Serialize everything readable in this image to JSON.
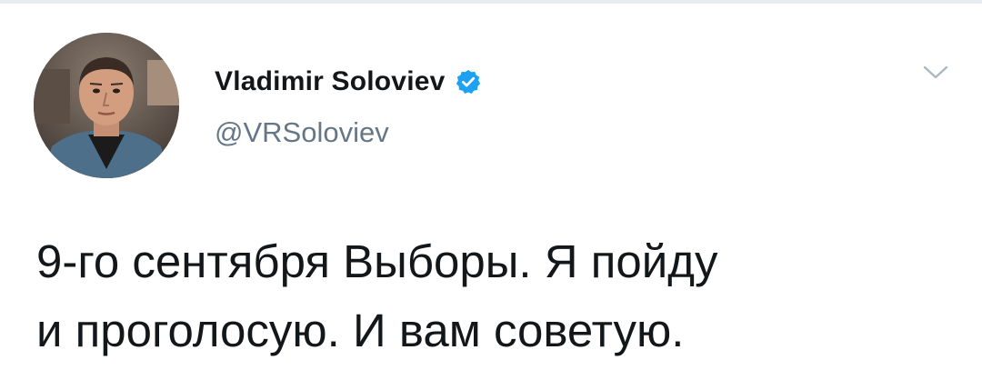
{
  "tweet": {
    "author": {
      "display_name": "Vladimir Soloviev",
      "handle": "@VRSoloviev",
      "verified": true,
      "avatar_icon": "profile-photo"
    },
    "text_lines": [
      "9-го сентября Выборы. Я пойду",
      "и проголосую. И вам советую."
    ],
    "menu_icon": "chevron-down-icon"
  },
  "colors": {
    "name": "#14171a",
    "handle": "#657786",
    "verified_badge": "#1da1f2",
    "caret": "#aab8c2",
    "divider": "#e6ecf0"
  }
}
